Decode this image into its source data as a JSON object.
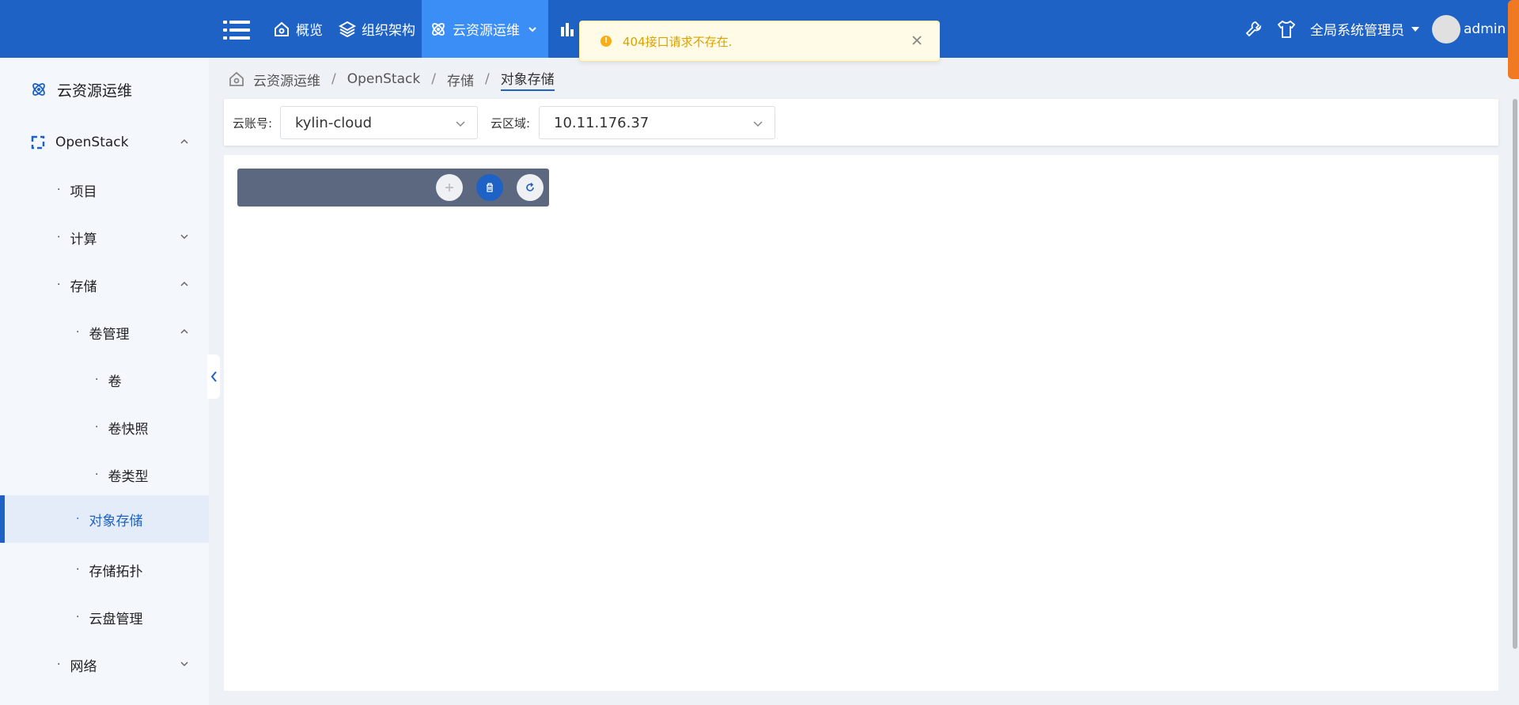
{
  "header": {
    "nav": [
      {
        "label": "概览",
        "icon": "home-icon"
      },
      {
        "label": "组织架构",
        "icon": "layers-icon"
      },
      {
        "label": "云资源运维",
        "icon": "atom-icon",
        "active": true
      },
      {
        "label": "",
        "icon": "bar-chart-icon"
      }
    ],
    "role_label": "全局系统管理员",
    "user_name": "admin"
  },
  "toast": {
    "message": "404接口请求不存在."
  },
  "sidebar": {
    "title": "云资源运维",
    "items": [
      {
        "label": "OpenStack",
        "level": 0,
        "expanded": true
      },
      {
        "label": "项目",
        "level": 1
      },
      {
        "label": "计算",
        "level": 1,
        "expanded": false
      },
      {
        "label": "存储",
        "level": 1,
        "expanded": true
      },
      {
        "label": "卷管理",
        "level": 2,
        "expanded": true
      },
      {
        "label": "卷",
        "level": 3
      },
      {
        "label": "卷快照",
        "level": 3
      },
      {
        "label": "卷类型",
        "level": 3
      },
      {
        "label": "对象存储",
        "level": 2,
        "active": true
      },
      {
        "label": "存储拓扑",
        "level": 2
      },
      {
        "label": "云盘管理",
        "level": 2
      },
      {
        "label": "网络",
        "level": 1,
        "expanded": false
      }
    ]
  },
  "breadcrumb": [
    "云资源运维",
    "OpenStack",
    "存储",
    "对象存储"
  ],
  "filters": {
    "account_label": "云账号:",
    "account_value": "kylin-cloud",
    "region_label": "云区域:",
    "region_value": "10.11.176.37"
  },
  "colors": {
    "primary": "#1e62c5",
    "nav_active": "#3a8ef5",
    "toolbar": "#5c6880",
    "warning": "#faad14"
  }
}
